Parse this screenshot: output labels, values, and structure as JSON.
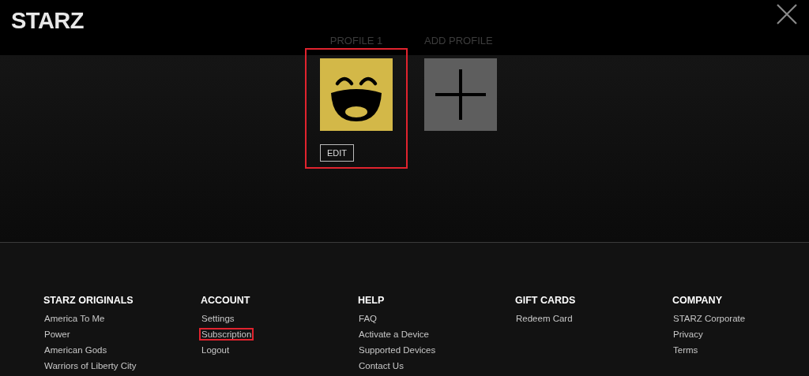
{
  "logo": "STARZ",
  "profiles": [
    {
      "kind": "avatar",
      "label": "PROFILE 1",
      "edit": "EDIT",
      "highlighted": true
    },
    {
      "kind": "add",
      "label": "ADD PROFILE",
      "highlighted": false
    }
  ],
  "footer": [
    {
      "heading": "STARZ ORIGINALS",
      "links": [
        {
          "text": "America To Me",
          "highlighted": false
        },
        {
          "text": "Power",
          "highlighted": false
        },
        {
          "text": "American Gods",
          "highlighted": false
        },
        {
          "text": "Warriors of Liberty City",
          "highlighted": false
        }
      ]
    },
    {
      "heading": "ACCOUNT",
      "links": [
        {
          "text": "Settings",
          "highlighted": false
        },
        {
          "text": "Subscription",
          "highlighted": true
        },
        {
          "text": "Logout",
          "highlighted": false
        }
      ]
    },
    {
      "heading": "HELP",
      "links": [
        {
          "text": "FAQ",
          "highlighted": false
        },
        {
          "text": "Activate a Device",
          "highlighted": false
        },
        {
          "text": "Supported Devices",
          "highlighted": false
        },
        {
          "text": "Contact Us",
          "highlighted": false
        }
      ]
    },
    {
      "heading": "GIFT CARDS",
      "links": [
        {
          "text": "Redeem Card",
          "highlighted": false
        }
      ]
    },
    {
      "heading": "COMPANY",
      "links": [
        {
          "text": "STARZ Corporate",
          "highlighted": false
        },
        {
          "text": "Privacy",
          "highlighted": false
        },
        {
          "text": "Terms",
          "highlighted": false
        }
      ]
    }
  ]
}
